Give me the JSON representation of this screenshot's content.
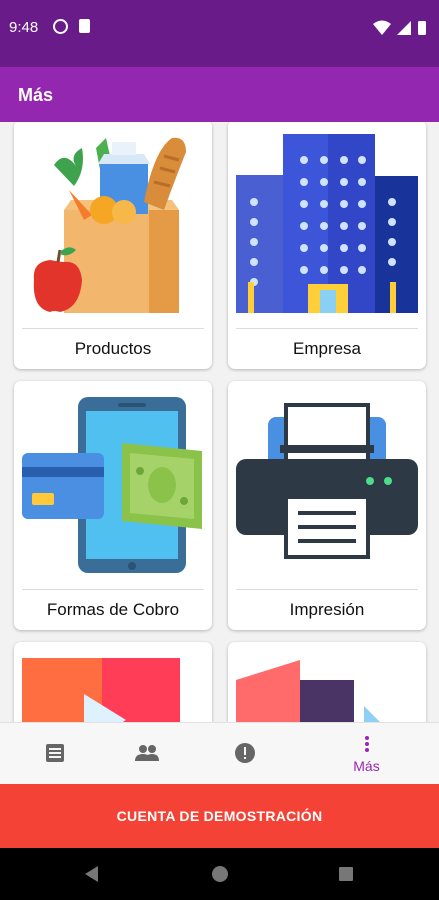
{
  "status_bar": {
    "time": "9:48"
  },
  "app_bar": {
    "title": "Más"
  },
  "menu_cards": [
    {
      "label": "Productos",
      "icon": "grocery-bag-icon"
    },
    {
      "label": "Empresa",
      "icon": "office-building-icon"
    },
    {
      "label": "Formas de Cobro",
      "icon": "payment-methods-icon"
    },
    {
      "label": "Impresión",
      "icon": "printer-icon"
    },
    {
      "label": "",
      "icon": "video-player-icon"
    },
    {
      "label": "",
      "icon": "shapes-icon"
    }
  ],
  "bottom_nav": {
    "items": [
      {
        "icon": "document-list-icon",
        "label": ""
      },
      {
        "icon": "people-icon",
        "label": ""
      },
      {
        "icon": "alert-icon",
        "label": ""
      },
      {
        "icon": "more-vertical-icon",
        "label": "Más",
        "selected": true
      }
    ]
  },
  "demo_banner": {
    "text": "CUENTA DE DEMOSTRACIÓN"
  },
  "colors": {
    "status_bar": "#6a1b8a",
    "app_bar": "#9427b0",
    "accent": "#9c27b0",
    "banner": "#f44336"
  }
}
